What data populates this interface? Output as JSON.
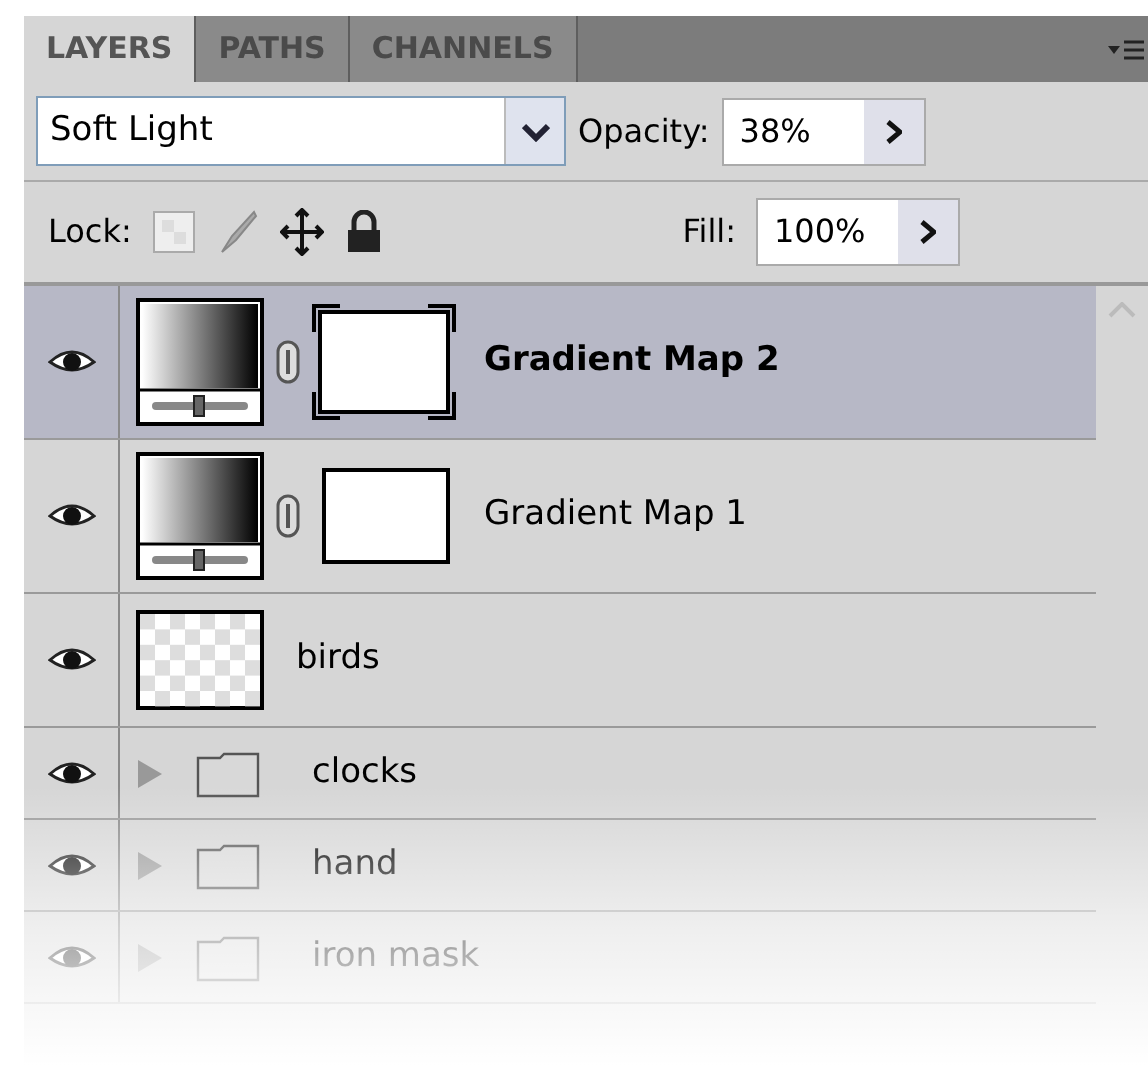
{
  "tabs": [
    {
      "label": "LAYERS",
      "selected": true
    },
    {
      "label": "PATHS",
      "selected": false
    },
    {
      "label": "CHANNELS",
      "selected": false
    }
  ],
  "blend_mode": {
    "value": "Soft Light"
  },
  "opacity": {
    "label": "Opacity:",
    "value": "38%"
  },
  "lock": {
    "label": "Lock:"
  },
  "fill": {
    "label": "Fill:",
    "value": "100%"
  },
  "layers": [
    {
      "kind": "adjustment",
      "name": "Gradient Map 2",
      "selected": true,
      "visible": true
    },
    {
      "kind": "adjustment",
      "name": "Gradient Map 1",
      "selected": false,
      "visible": true
    },
    {
      "kind": "pixel",
      "name": "birds",
      "selected": false,
      "visible": true
    },
    {
      "kind": "group",
      "name": "clocks",
      "selected": false,
      "visible": true
    },
    {
      "kind": "group",
      "name": "hand",
      "selected": false,
      "visible": true
    },
    {
      "kind": "group",
      "name": "iron mask",
      "selected": false,
      "visible": true
    }
  ]
}
